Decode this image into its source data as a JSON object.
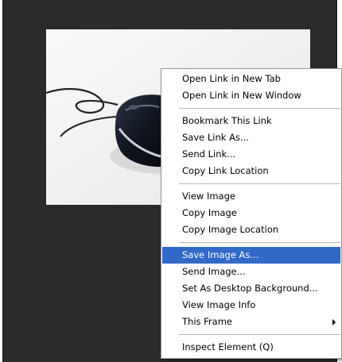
{
  "page": {
    "background": "#ffffff",
    "viewport_color": "#2b2b2b"
  },
  "photo": {
    "subject": "computer-mouse-icon"
  },
  "context_menu": {
    "highlight_color": "#3268c8",
    "groups": [
      [
        {
          "label": "Open Link in New Tab"
        },
        {
          "label": "Open Link in New Window"
        }
      ],
      [
        {
          "label": "Bookmark This Link"
        },
        {
          "label": "Save Link As..."
        },
        {
          "label": "Send Link..."
        },
        {
          "label": "Copy Link Location"
        }
      ],
      [
        {
          "label": "View Image"
        },
        {
          "label": "Copy Image"
        },
        {
          "label": "Copy Image Location"
        }
      ],
      [
        {
          "label": "Save Image As...",
          "highlighted": true
        },
        {
          "label": "Send Image..."
        },
        {
          "label": "Set As Desktop Background..."
        },
        {
          "label": "View Image Info"
        },
        {
          "label": "This Frame",
          "submenu": true
        }
      ],
      [
        {
          "label": "Inspect Element (Q)"
        }
      ]
    ]
  }
}
